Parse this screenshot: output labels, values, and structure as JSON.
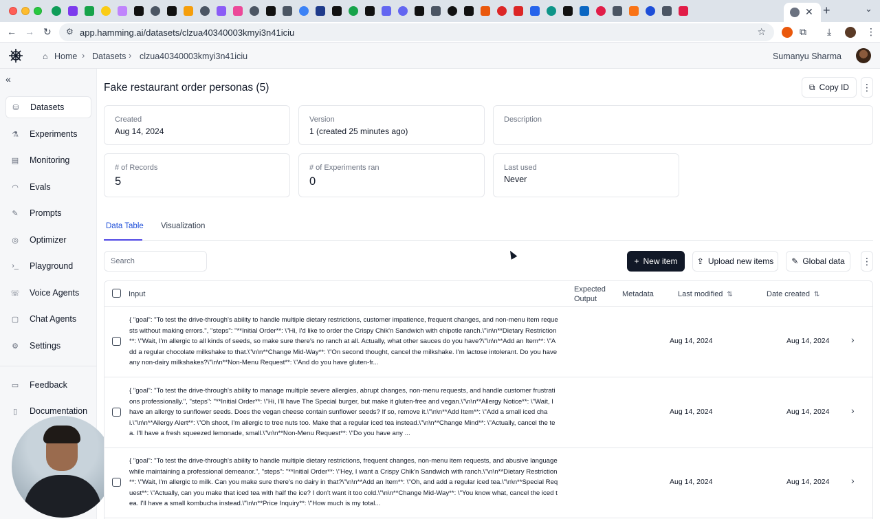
{
  "browser": {
    "url": "app.hamming.ai/datasets/clzua40340003kmyi3n41iciu",
    "favicon_colors": [
      "#0f9d58",
      "#7c3aed",
      "#16a34a",
      "#facc15",
      "#c084fc",
      "#111111",
      "#4b5563",
      "#111111",
      "#f59e0b",
      "#4b5563",
      "#8b5cf6",
      "#ec4899",
      "#4b5563",
      "#111111",
      "#4b5563",
      "#3b82f6",
      "#1e3a8a",
      "#111111",
      "#16a34a",
      "#111111",
      "#6366f1",
      "#6366f1",
      "#111111",
      "#4b5563",
      "#111111",
      "#111111",
      "#ea580c",
      "#dc2626",
      "#dc2626",
      "#2563eb",
      "#0d9488",
      "#111111",
      "#0a66c2",
      "#e11d48",
      "#4b5563",
      "#f97316",
      "#1d4ed8",
      "#4b5563",
      "#e11d48"
    ]
  },
  "header": {
    "breadcrumbs": [
      "Home",
      "Datasets",
      "clzua40340003kmyi3n41iciu"
    ],
    "user_name": "Sumanyu Sharma"
  },
  "sidebar": {
    "items": [
      {
        "label": "Datasets",
        "icon": "database-icon"
      },
      {
        "label": "Experiments",
        "icon": "flask-icon"
      },
      {
        "label": "Monitoring",
        "icon": "chart-icon"
      },
      {
        "label": "Evals",
        "icon": "gauge-icon"
      },
      {
        "label": "Prompts",
        "icon": "pencil-icon"
      },
      {
        "label": "Optimizer",
        "icon": "target-icon"
      },
      {
        "label": "Playground",
        "icon": "terminal-icon"
      },
      {
        "label": "Voice Agents",
        "icon": "phone-icon"
      },
      {
        "label": "Chat Agents",
        "icon": "chat-icon"
      },
      {
        "label": "Settings",
        "icon": "gear-icon"
      }
    ],
    "footer_items": [
      {
        "label": "Feedback",
        "icon": "message-icon"
      },
      {
        "label": "Documentation",
        "icon": "book-icon"
      }
    ]
  },
  "page": {
    "title": "Fake restaurant order personas (5)",
    "copy_id_label": "Copy ID"
  },
  "cards": {
    "created": {
      "label": "Created",
      "value": "Aug 14, 2024"
    },
    "version": {
      "label": "Version",
      "value": "1 (created 25 minutes ago)"
    },
    "description": {
      "label": "Description",
      "value": ""
    },
    "records": {
      "label": "# of Records",
      "value": "5"
    },
    "experiments": {
      "label": "# of Experiments ran",
      "value": "0"
    },
    "last_used": {
      "label": "Last used",
      "value": "Never"
    }
  },
  "tabs": [
    "Data Table",
    "Visualization"
  ],
  "search": {
    "placeholder": "Search"
  },
  "actions": {
    "new_item": "New item",
    "upload": "Upload new items",
    "global_data": "Global data"
  },
  "table": {
    "columns": {
      "input": "Input",
      "expected_output": "Expected Output",
      "metadata": "Metadata",
      "last_modified": "Last modified",
      "date_created": "Date created"
    },
    "rows": [
      {
        "input": "{ \"goal\": \"To test the drive-through's ability to handle multiple dietary restrictions, customer impatience, frequent changes, and non-menu item requests without making errors.\", \"steps\": \"**Initial Order**: \\\"Hi, I'd like to order the Crispy Chik'n Sandwich with chipotle ranch.\\\"\\n\\n**Dietary Restriction**: \\\"Wait, I'm allergic to all kinds of seeds, so make sure there's no ranch at all. Actually, what other sauces do you have?\\\"\\n\\n**Add an Item**: \\\"Add a regular chocolate milkshake to that.\\\"\\n\\n**Change Mid-Way**: \\\"On second thought, cancel the milkshake. I'm lactose intolerant. Do you have any non-dairy milkshakes?\\\"\\n\\n**Non-Menu Request**: \\\"And do you have gluten-fr...",
        "last_modified": "Aug 14, 2024",
        "date_created": "Aug 14, 2024"
      },
      {
        "input": "{ \"goal\": \"To test the drive-through's ability to manage multiple severe allergies, abrupt changes, non-menu requests, and handle customer frustrations professionally.\", \"steps\": \"**Initial Order**: \\\"Hi, I'll have The Special burger, but make it gluten-free and vegan.\\\"\\n\\n**Allergy Notice**: \\\"Wait, I have an allergy to sunflower seeds. Does the vegan cheese contain sunflower seeds? If so, remove it.\\\"\\n\\n**Add Item**: \\\"Add a small iced chai.\\\"\\n\\n**Allergy Alert**: \\\"Oh shoot, I'm allergic to tree nuts too. Make that a regular iced tea instead.\\\"\\n\\n**Change Mind**: \\\"Actually, cancel the tea. I'll have a fresh squeezed lemonade, small.\\\"\\n\\n**Non-Menu Request**: \\\"Do you have any ...",
        "last_modified": "Aug 14, 2024",
        "date_created": "Aug 14, 2024"
      },
      {
        "input": "{ \"goal\": \"To test the drive-through's ability to handle multiple dietary restrictions, frequent changes, non-menu item requests, and abusive language while maintaining a professional demeanor.\", \"steps\": \"**Initial Order**: \\\"Hey, I want a Crispy Chik'n Sandwich with ranch.\\\"\\n\\n**Dietary Restriction**: \\\"Wait, I'm allergic to milk. Can you make sure there's no dairy in that?\\\"\\n\\n**Add an Item**: \\\"Oh, and add a regular iced tea.\\\"\\n\\n**Special Request**: \\\"Actually, can you make that iced tea with half the ice? I don't want it too cold.\\\"\\n\\n**Change Mid-Way**: \\\"You know what, cancel the iced tea. I'll have a small kombucha instead.\\\"\\n\\n**Price Inquiry**: \\\"How much is my total...",
        "last_modified": "Aug 14, 2024",
        "date_created": "Aug 14, 2024"
      }
    ]
  }
}
